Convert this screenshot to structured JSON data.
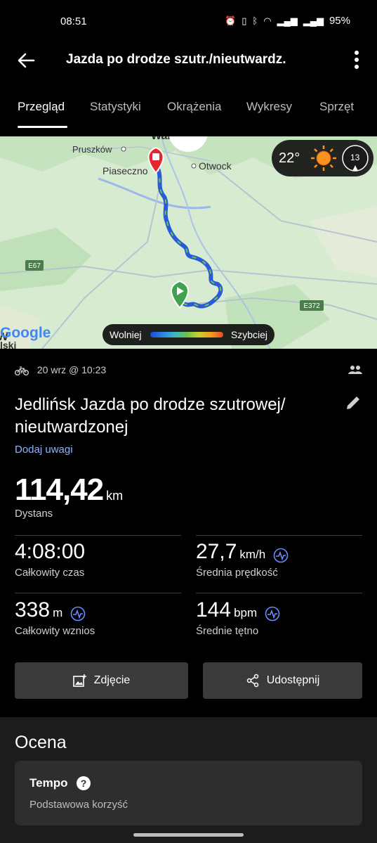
{
  "status_bar": {
    "time": "08:51",
    "battery": "95%"
  },
  "app_bar": {
    "title": "Jazda po drodze szutr./nieutwardz."
  },
  "tabs": [
    {
      "label": "Przegląd"
    },
    {
      "label": "Statystyki"
    },
    {
      "label": "Okrążenia"
    },
    {
      "label": "Wykresy"
    },
    {
      "label": "Sprzęt"
    }
  ],
  "map": {
    "places": [
      "Pruszków",
      "Piaseczno",
      "Otwock",
      "Warszawa"
    ],
    "roads": [
      "E67",
      "E372"
    ],
    "attribution": "Google",
    "attribution_left": "w",
    "attribution_bottom": "lski",
    "weather": {
      "temp": "22°",
      "wind": "13"
    },
    "legend": {
      "slow": "Wolniej",
      "fast": "Szybciej"
    }
  },
  "activity": {
    "date": "20 wrz @ 10:23",
    "title": "Jedlińsk Jazda po drodze szutrowej/ nieutwardzonej",
    "add_notes": "Dodaj uwagi",
    "distance": {
      "value": "114,42",
      "unit": "km",
      "label": "Dystans"
    },
    "stats": [
      {
        "value": "4:08:00",
        "unit": "",
        "label": "Całkowity czas"
      },
      {
        "value": "27,7",
        "unit": "km/h",
        "label": "Średnia prędkość"
      },
      {
        "value": "338",
        "unit": "m",
        "label": "Całkowity wznios"
      },
      {
        "value": "144",
        "unit": "bpm",
        "label": "Średnie tętno"
      }
    ]
  },
  "buttons": {
    "photo": "Zdjęcie",
    "share": "Udostępnij"
  },
  "rating": {
    "heading": "Ocena",
    "card_title": "Tempo",
    "card_subtitle": "Podstawowa korzyść"
  },
  "colors": {
    "background": "#000000",
    "link": "#8fb4ff",
    "pin": "#e5262f",
    "start": "#4caf50",
    "track": "#2a5bd7"
  }
}
